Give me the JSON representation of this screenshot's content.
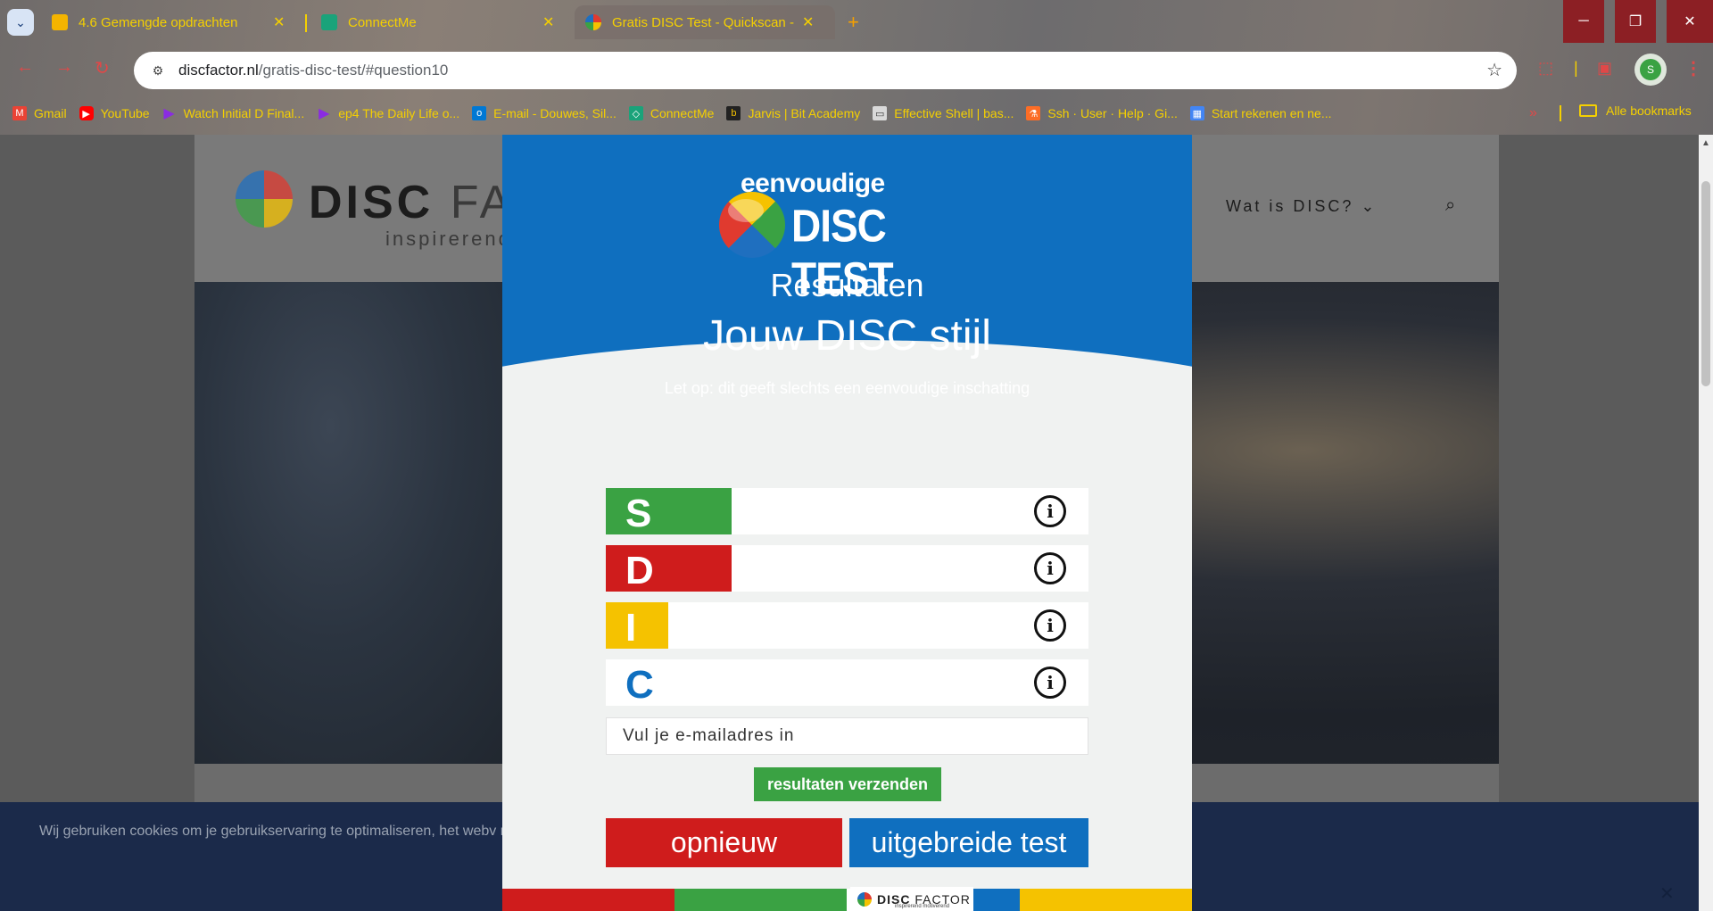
{
  "browser": {
    "tabs": [
      {
        "title": "4.6 Gemengde opdrachten",
        "favicon_color": "#f4b400"
      },
      {
        "title": "ConnectMe",
        "favicon_color": "#1aa37a"
      },
      {
        "title": "Gratis DISC Test - Quickscan - D",
        "favicon_color": "#e03a2f"
      }
    ],
    "active_tab": 2,
    "url_host": "discfactor.nl",
    "url_path": "/gratis-disc-test/#question10",
    "profile_initial": "S",
    "bookmarks": [
      {
        "label": "Gmail",
        "icon_color": "#ea4335"
      },
      {
        "label": "YouTube",
        "icon_color": "#ff0000"
      },
      {
        "label": "Watch Initial D Final...",
        "icon_color": "#8a2be2"
      },
      {
        "label": "ep4 The Daily Life o...",
        "icon_color": "#8a2be2"
      },
      {
        "label": "E-mail - Douwes, Sil...",
        "icon_color": "#0078d4"
      },
      {
        "label": "ConnectMe",
        "icon_color": "#1aa37a"
      },
      {
        "label": "Jarvis | Bit Academy",
        "icon_color": "#222222"
      },
      {
        "label": "Effective Shell | bas...",
        "icon_color": "#d9d9d9"
      },
      {
        "label": "Ssh · User · Help · Gi...",
        "icon_color": "#fc6d26"
      },
      {
        "label": "Start rekenen en ne...",
        "icon_color": "#4285f4"
      }
    ],
    "all_bookmarks": "Alle bookmarks"
  },
  "site": {
    "logo_main": "DISC",
    "logo_rest": "FA",
    "tagline": "inspirerend",
    "nav_item": "Wat is DISC? ⌄",
    "cookie_text": "Wij gebruiken cookies om je gebruikservaring te optimaliseren, het webv                                                                                                                                                                                                      ngen\" te klikken. Als je akkoord gaat met ons gebruik van cookies, klik je",
    "cookie_close": "✕"
  },
  "modal": {
    "brand_top": "eenvoudige",
    "brand_main": "DISC TEST",
    "heading_results": "Resultaten",
    "heading_style": "Jouw DISC stijl",
    "note": "Let op: dit geeft slechts een eenvoudige inschatting",
    "results": [
      {
        "letter": "S",
        "score_fraction": 0.26,
        "color": "#3aa243",
        "letter_color": "#ffffff"
      },
      {
        "letter": "D",
        "score_fraction": 0.26,
        "color": "#cf1c1c",
        "letter_color": "#ffffff"
      },
      {
        "letter": "I",
        "score_fraction": 0.13,
        "color": "#f5c200",
        "letter_color": "#ffffff"
      },
      {
        "letter": "C",
        "score_fraction": 0.0,
        "color": "#0f6fbf",
        "letter_color": "#0f6fbf"
      }
    ],
    "info_glyph": "i",
    "email_placeholder": "Vul je e-mailadres in",
    "send_label": "resultaten verzenden",
    "again_label": "opnieuw",
    "extended_label": "uitgebreide test",
    "footer_logo_bold": "DISC",
    "footer_logo_light": " FACTOR",
    "footer_logo_sub": "inspirerend motiverend",
    "footer_colors": [
      "#cf1c1c",
      "#3aa243",
      "#ffffff",
      "#0f6fbf",
      "#f5c200"
    ]
  }
}
